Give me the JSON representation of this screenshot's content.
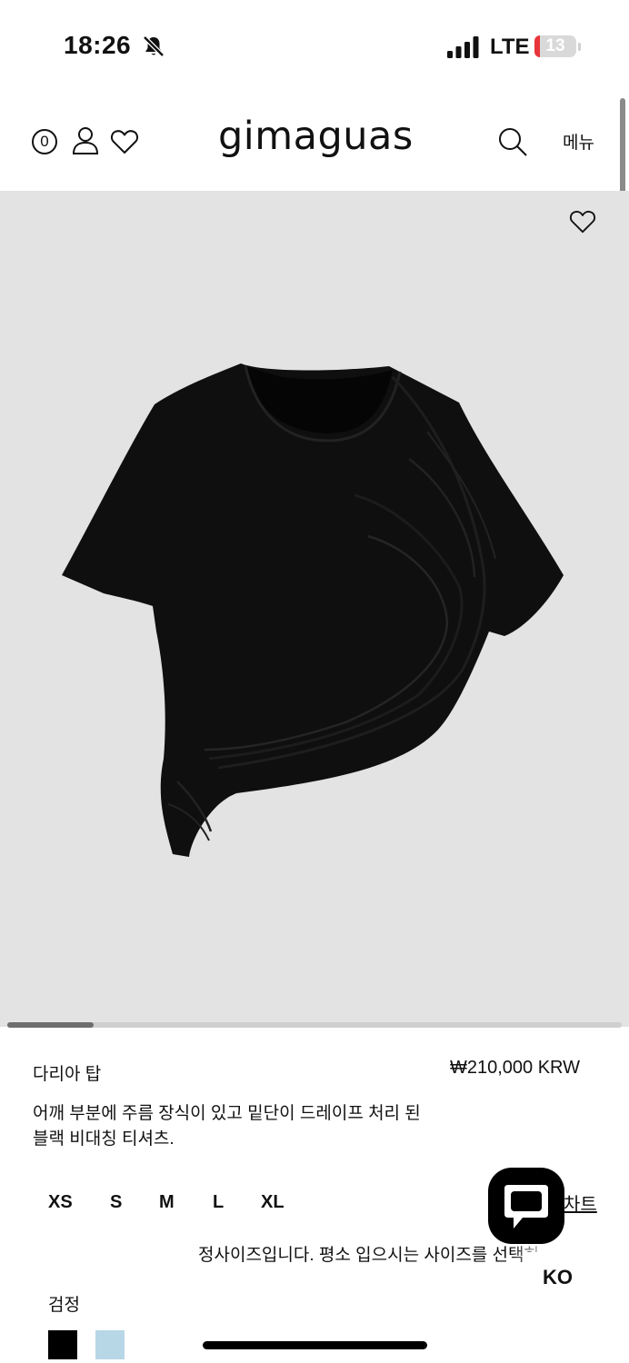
{
  "status_bar": {
    "time": "18:26",
    "network": "LTE",
    "battery": "13",
    "battery_level": 0.13
  },
  "header": {
    "cart_count": "0",
    "brand": "gimaguas",
    "menu_label": "메뉴"
  },
  "gallery": {
    "position": 1,
    "progress": 0.14
  },
  "product": {
    "name": "다리아 탑",
    "price": "₩210,000 KRW",
    "description": "어깨 부분에 주름 장식이 있고 밑단이 드레이프 처리 된 블랙 비대칭 티셔츠.",
    "color": "#0f0f10"
  },
  "sizes": {
    "options": [
      "XS",
      "S",
      "M",
      "L",
      "XL"
    ],
    "chart_link": "차트",
    "fit_note": "정사이즈입니다. 평소 입으시는 사이즈를 선택하세요."
  },
  "colors": {
    "label": "검정",
    "swatches": [
      "#000000",
      "#b7d7e6"
    ]
  },
  "language": {
    "current": "KO"
  },
  "icons": {
    "status": [
      "bell-slash-icon",
      "signal-icon",
      "battery-icon"
    ],
    "header": [
      "cart-count-icon",
      "user-icon",
      "heart-icon",
      "search-icon"
    ],
    "floating": [
      "chat-bubble-icon"
    ]
  }
}
